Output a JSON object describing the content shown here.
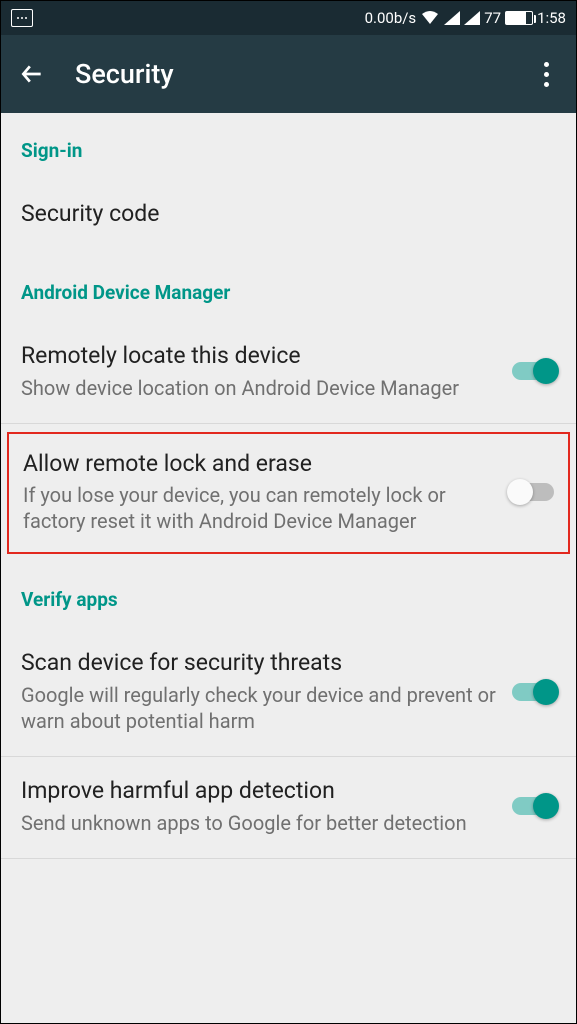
{
  "status": {
    "speed": "0.00b/s",
    "battery": "77",
    "time": "1:58"
  },
  "header": {
    "title": "Security"
  },
  "sections": {
    "signin": {
      "header": "Sign-in",
      "item1_title": "Security code"
    },
    "adm": {
      "header": "Android Device Manager",
      "locate_title": "Remotely locate this device",
      "locate_sub": "Show device location on Android Device Manager",
      "lock_title": "Allow remote lock and erase",
      "lock_sub": "If you lose your device, you can remotely lock or factory reset it with Android Device Manager"
    },
    "verify": {
      "header": "Verify apps",
      "scan_title": "Scan device for security threats",
      "scan_sub": "Google will regularly check your device and prevent or warn about potential harm",
      "improve_title": "Improve harmful app detection",
      "improve_sub": "Send unknown apps to Google for better detection"
    }
  }
}
